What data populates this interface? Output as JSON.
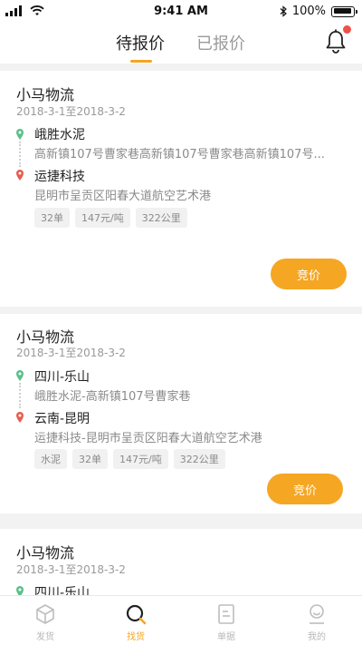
{
  "status_bar": {
    "time": "9:41 AM",
    "battery": "100%"
  },
  "header": {
    "tabs": [
      {
        "label": "待报价",
        "active": true
      },
      {
        "label": "已报价",
        "active": false
      }
    ],
    "notification_badge": true
  },
  "orders": [
    {
      "company": "小马物流",
      "date_range": "2018-3-1至2018-3-2",
      "origin": {
        "title": "峨胜水泥",
        "address": "高新镇107号曹家巷高新镇107号曹家巷高新镇107号..."
      },
      "destination": {
        "title": "运捷科技",
        "address": "昆明市呈贡区阳春大道航空艺术港"
      },
      "tags": [
        "32单",
        "147元/吨",
        "322公里"
      ],
      "action_label": "竞价"
    },
    {
      "company": "小马物流",
      "date_range": "2018-3-1至2018-3-2",
      "origin": {
        "title": "四川-乐山",
        "address": "峨胜水泥-高新镇107号曹家巷"
      },
      "destination": {
        "title": "云南-昆明",
        "address": "运捷科技-昆明市呈贡区阳春大道航空艺术港"
      },
      "tags": [
        "水泥",
        "32单",
        "147元/吨",
        "322公里"
      ],
      "action_label": "竞价"
    },
    {
      "company": "小马物流",
      "date_range": "2018-3-1至2018-3-2",
      "origin": {
        "title": "四川-乐山"
      }
    }
  ],
  "tabbar": [
    {
      "label": "发货",
      "icon": "cube-icon",
      "active": false
    },
    {
      "label": "找货",
      "icon": "search-icon",
      "active": true
    },
    {
      "label": "单据",
      "icon": "document-icon",
      "active": false
    },
    {
      "label": "我的",
      "icon": "profile-icon",
      "active": false
    }
  ],
  "colors": {
    "accent": "#f5a623",
    "badge": "#f0504a",
    "origin_pin": "#5cc08a",
    "destination_pin": "#e85c50"
  }
}
